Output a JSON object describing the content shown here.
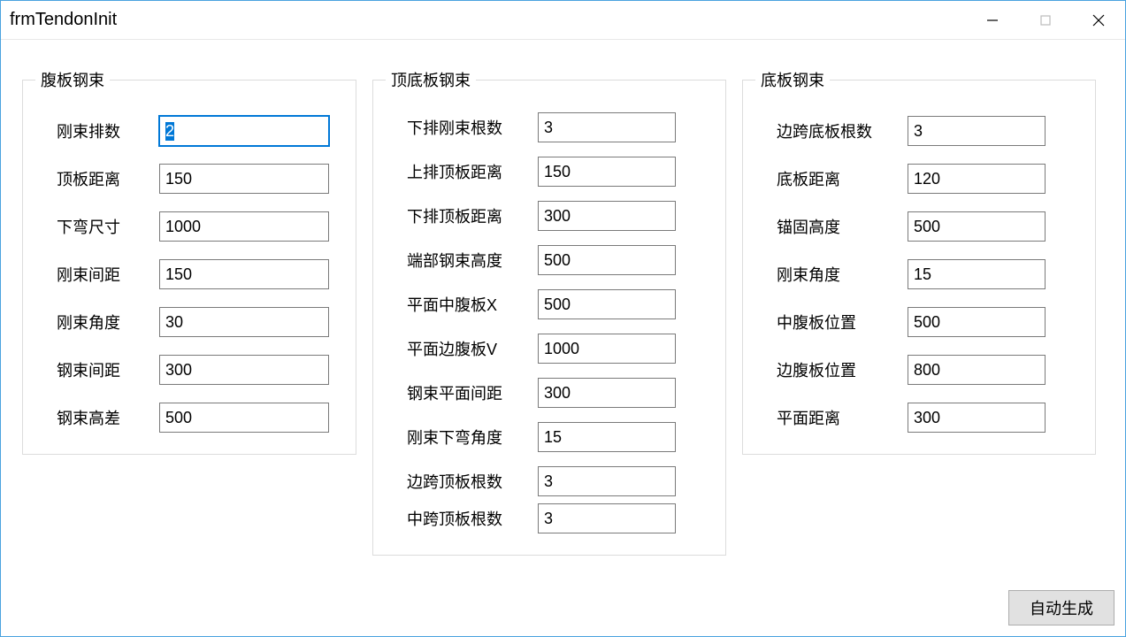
{
  "window": {
    "title": "frmTendonInit"
  },
  "group1": {
    "legend": "腹板钢束",
    "fields": [
      {
        "label": "刚束排数",
        "value": "2",
        "focused": true
      },
      {
        "label": "顶板距离",
        "value": "150"
      },
      {
        "label": "下弯尺寸",
        "value": "1000"
      },
      {
        "label": "刚束间距",
        "value": "150"
      },
      {
        "label": "刚束角度",
        "value": "30"
      },
      {
        "label": "钢束间距",
        "value": "300"
      },
      {
        "label": "钢束高差",
        "value": "500"
      }
    ]
  },
  "group2": {
    "legend": "顶底板钢束",
    "fields": [
      {
        "label": "下排刚束根数",
        "value": "3"
      },
      {
        "label": "上排顶板距离",
        "value": "150"
      },
      {
        "label": "下排顶板距离",
        "value": "300"
      },
      {
        "label": "端部钢束高度",
        "value": "500"
      },
      {
        "label": "平面中腹板X",
        "value": "500"
      },
      {
        "label": "平面边腹板V",
        "value": "1000"
      },
      {
        "label": "钢束平面间距",
        "value": "300"
      },
      {
        "label": "刚束下弯角度",
        "value": "15"
      },
      {
        "label": "边跨顶板根数",
        "value": "3"
      },
      {
        "label": "中跨顶板根数",
        "value": "3"
      }
    ]
  },
  "group3": {
    "legend": "底板钢束",
    "fields": [
      {
        "label": "边跨底板根数",
        "value": "3"
      },
      {
        "label": "底板距离",
        "value": "120"
      },
      {
        "label": "锚固高度",
        "value": "500"
      },
      {
        "label": "刚束角度",
        "value": "15"
      },
      {
        "label": "中腹板位置",
        "value": "500"
      },
      {
        "label": "边腹板位置",
        "value": "800"
      },
      {
        "label": "平面距离",
        "value": "300"
      }
    ]
  },
  "footer": {
    "generate_label": "自动生成"
  }
}
